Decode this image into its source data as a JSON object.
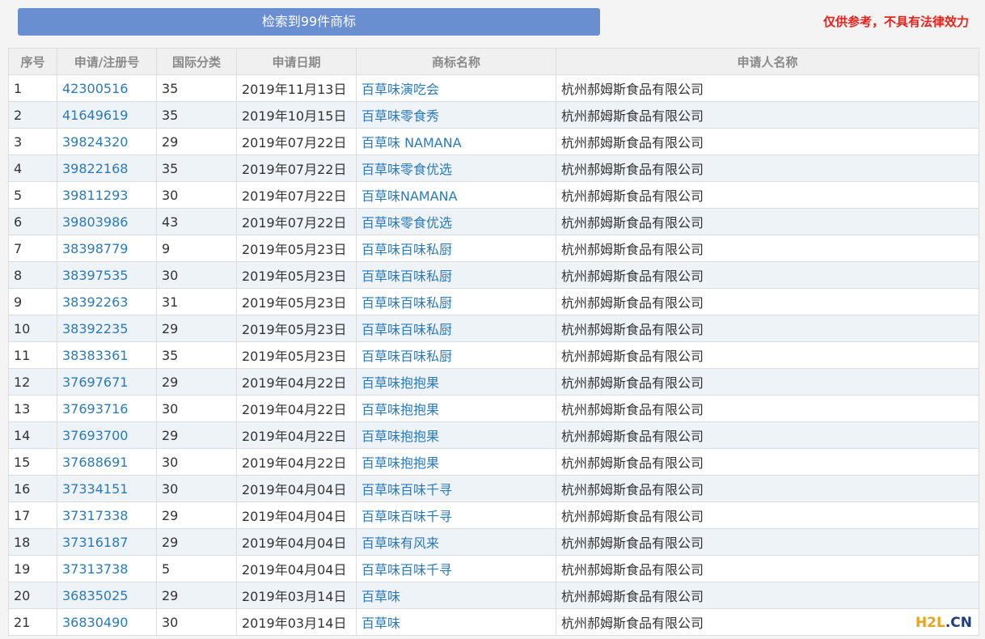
{
  "header": {
    "result_label": "检索到99件商标",
    "disclaimer": "仅供参考，不具有法律效力"
  },
  "table": {
    "columns": [
      "序号",
      "申请/注册号",
      "国际分类",
      "申请日期",
      "商标名称",
      "申请人名称"
    ],
    "rows": [
      [
        "1",
        "42300516",
        "35",
        "2019年11月13日",
        "百草味演吃会",
        "杭州郝姆斯食品有限公司"
      ],
      [
        "2",
        "41649619",
        "35",
        "2019年10月15日",
        "百草味零食秀",
        "杭州郝姆斯食品有限公司"
      ],
      [
        "3",
        "39824320",
        "29",
        "2019年07月22日",
        "百草味 NAMANA",
        "杭州郝姆斯食品有限公司"
      ],
      [
        "4",
        "39822168",
        "35",
        "2019年07月22日",
        "百草味零食优选",
        "杭州郝姆斯食品有限公司"
      ],
      [
        "5",
        "39811293",
        "30",
        "2019年07月22日",
        "百草味NAMANA",
        "杭州郝姆斯食品有限公司"
      ],
      [
        "6",
        "39803986",
        "43",
        "2019年07月22日",
        "百草味零食优选",
        "杭州郝姆斯食品有限公司"
      ],
      [
        "7",
        "38398779",
        "9",
        "2019年05月23日",
        "百草味百味私厨",
        "杭州郝姆斯食品有限公司"
      ],
      [
        "8",
        "38397535",
        "30",
        "2019年05月23日",
        "百草味百味私厨",
        "杭州郝姆斯食品有限公司"
      ],
      [
        "9",
        "38392263",
        "31",
        "2019年05月23日",
        "百草味百味私厨",
        "杭州郝姆斯食品有限公司"
      ],
      [
        "10",
        "38392235",
        "29",
        "2019年05月23日",
        "百草味百味私厨",
        "杭州郝姆斯食品有限公司"
      ],
      [
        "11",
        "38383361",
        "35",
        "2019年05月23日",
        "百草味百味私厨",
        "杭州郝姆斯食品有限公司"
      ],
      [
        "12",
        "37697671",
        "29",
        "2019年04月22日",
        "百草味抱抱果",
        "杭州郝姆斯食品有限公司"
      ],
      [
        "13",
        "37693716",
        "30",
        "2019年04月22日",
        "百草味抱抱果",
        "杭州郝姆斯食品有限公司"
      ],
      [
        "14",
        "37693700",
        "29",
        "2019年04月22日",
        "百草味抱抱果",
        "杭州郝姆斯食品有限公司"
      ],
      [
        "15",
        "37688691",
        "30",
        "2019年04月22日",
        "百草味抱抱果",
        "杭州郝姆斯食品有限公司"
      ],
      [
        "16",
        "37334151",
        "30",
        "2019年04月04日",
        "百草味百味千寻",
        "杭州郝姆斯食品有限公司"
      ],
      [
        "17",
        "37317338",
        "29",
        "2019年04月04日",
        "百草味百味千寻",
        "杭州郝姆斯食品有限公司"
      ],
      [
        "18",
        "37316187",
        "29",
        "2019年04月04日",
        "百草味有风来",
        "杭州郝姆斯食品有限公司"
      ],
      [
        "19",
        "37313738",
        "5",
        "2019年04月04日",
        "百草味百味千寻",
        "杭州郝姆斯食品有限公司"
      ],
      [
        "20",
        "36835025",
        "29",
        "2019年03月14日",
        "百草味",
        "杭州郝姆斯食品有限公司"
      ],
      [
        "21",
        "36830490",
        "30",
        "2019年03月14日",
        "百草味",
        "杭州郝姆斯食品有限公司"
      ]
    ]
  },
  "watermark": {
    "brand": "H2L",
    "suffix": ".CN"
  },
  "colors": {
    "button_bg": "#6a8fd0",
    "link": "#2a7ab8",
    "disclaimer": "#e8201a",
    "stripe": "#eef3f8"
  }
}
